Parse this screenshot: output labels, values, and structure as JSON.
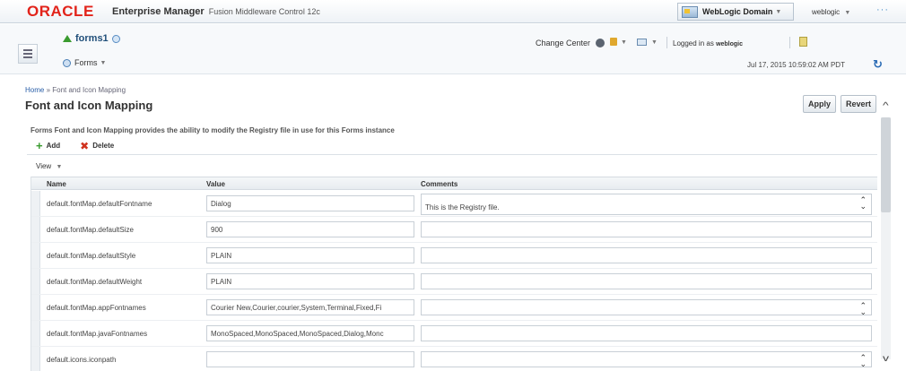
{
  "header": {
    "logo": "ORACLE",
    "product": "Enterprise Manager",
    "subtitle": "Fusion Middleware Control 12c",
    "domain_label": "WebLogic Domain",
    "user": "weblogic",
    "more": "···"
  },
  "target": {
    "name": "forms1",
    "menu": "Forms",
    "change_center": "Change Center",
    "logged_in_prefix": "Logged in as",
    "logged_in_user": "weblogic",
    "timestamp": "Jul 17, 2015 10:59:02 AM PDT"
  },
  "page": {
    "breadcrumb_home": "Home",
    "breadcrumb_current": "Font and Icon Mapping",
    "title": "Font and Icon Mapping",
    "apply_label": "Apply",
    "revert_label": "Revert",
    "description": "Forms Font and Icon Mapping provides the ability to modify the Registry file in use for this Forms instance",
    "add_label": "Add",
    "delete_label": "Delete",
    "view_label": "View"
  },
  "table": {
    "columns": [
      "Name",
      "Value",
      "Comments"
    ],
    "rows": [
      {
        "name": "default.fontMap.defaultFontname",
        "value": "Dialog",
        "comment": "This is the Registry file."
      },
      {
        "name": "default.fontMap.defaultSize",
        "value": "900",
        "comment": ""
      },
      {
        "name": "default.fontMap.defaultStyle",
        "value": "PLAIN",
        "comment": ""
      },
      {
        "name": "default.fontMap.defaultWeight",
        "value": "PLAIN",
        "comment": ""
      },
      {
        "name": "default.fontMap.appFontnames",
        "value": "Courier New,Courier,courier,System,Terminal,Fixed,Fi",
        "comment": ""
      },
      {
        "name": "default.fontMap.javaFontnames",
        "value": "MonoSpaced,MonoSpaced,MonoSpaced,Dialog,Monc",
        "comment": ""
      },
      {
        "name": "default.icons.iconpath",
        "value": "",
        "comment": ""
      }
    ]
  },
  "colors": {
    "oracle_red": "#e2231a",
    "link_blue": "#2a5fa8",
    "add_green": "#3a9b2f",
    "delete_red": "#d0321e"
  }
}
